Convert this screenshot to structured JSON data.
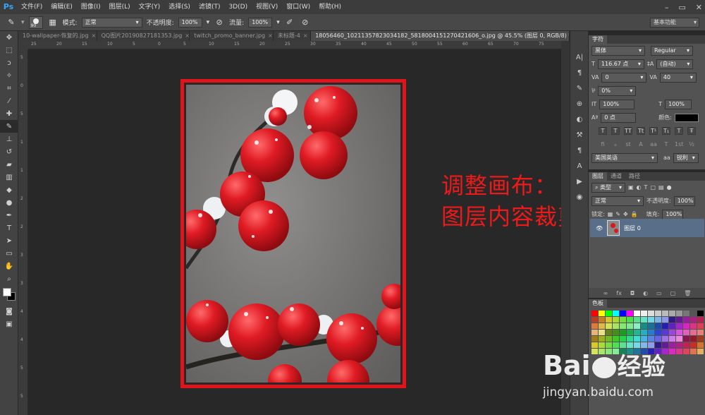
{
  "app": {
    "logo": "Ps"
  },
  "menu": [
    "文件(F)",
    "编辑(E)",
    "图像(I)",
    "图层(L)",
    "文字(Y)",
    "选择(S)",
    "滤镜(T)",
    "3D(D)",
    "视图(V)",
    "窗口(W)",
    "帮助(H)"
  ],
  "options": {
    "brush_size": "90",
    "mode_label": "模式:",
    "mode_value": "正常",
    "opacity_label": "不透明度:",
    "opacity_value": "100%",
    "flow_label": "流量:",
    "flow_value": "100%",
    "workspace": "基本功能"
  },
  "tabs": [
    {
      "label": "10-wallpaper-恢复的.jpg",
      "active": false
    },
    {
      "label": "QQ图片20190827181353.jpg",
      "active": false
    },
    {
      "label": "twitch_promo_banner.jpg",
      "active": false
    },
    {
      "label": "未标题-4",
      "active": false
    },
    {
      "label": "18056460_10211357823034182_5818004151270421606_o.jpg @ 45.5% (图层 0, RGB/8) *",
      "active": true
    }
  ],
  "ruler": {
    "h": [
      "25",
      "20",
      "15",
      "10",
      "5",
      "0",
      "5",
      "10",
      "15",
      "20",
      "25",
      "30",
      "35",
      "40",
      "45",
      "50",
      "55",
      "60",
      "65",
      "70",
      "75"
    ],
    "v": [
      "5",
      "0",
      "5",
      "1",
      "1",
      "2",
      "2",
      "3",
      "3",
      "4",
      "4",
      "5",
      "5"
    ]
  },
  "annotation": {
    "line1": "调整画布：",
    "line2": "图层内容裁剪"
  },
  "character_panel": {
    "tab": "字符",
    "font_family": "黑体",
    "font_style": "Regular",
    "font_size": "116.67 点",
    "leading": "(自动)",
    "kerning": "0",
    "tracking": "40",
    "scale_pct": "0%",
    "vscale": "100%",
    "hscale": "100%",
    "baseline": "0 点",
    "color_label": "颜色:",
    "type_buttons": [
      "T",
      "T",
      "TT",
      "Tt",
      "T¹",
      "T₁",
      "T",
      "Ŧ"
    ],
    "ot_buttons": [
      "fi",
      "ℴ",
      "st",
      "A",
      "aa",
      "T",
      "1st",
      "½"
    ],
    "language": "美国英语",
    "antialias": "锐利"
  },
  "layers_panel": {
    "tabs": [
      "图层",
      "通道",
      "路径"
    ],
    "kind_filter": "类型",
    "blend_mode": "正常",
    "opacity_label": "不透明度:",
    "opacity_value": "100%",
    "lock_label": "锁定:",
    "fill_label": "填充:",
    "fill_value": "100%",
    "layer_name": "图层 0"
  },
  "swatches_panel": {
    "tab": "色板"
  },
  "watermark": {
    "brand": "Bai",
    "brand2": "经验",
    "url": "jingyan.baidu.com"
  }
}
